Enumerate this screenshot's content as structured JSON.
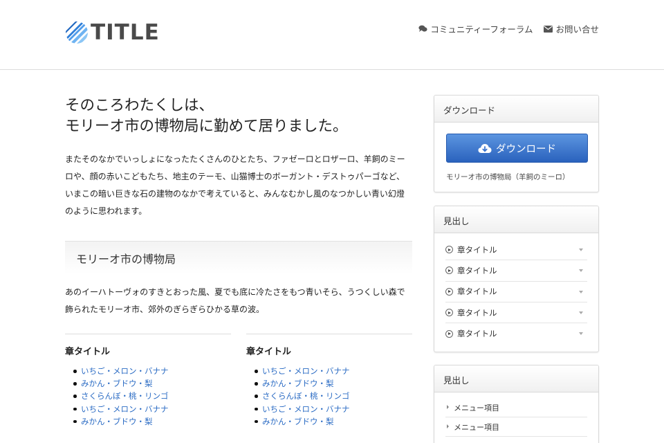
{
  "header": {
    "logo_text": "TITLE",
    "nav": [
      {
        "label": "コミュニティーフォーラム",
        "icon": "chat-icon"
      },
      {
        "label": "お問い合せ",
        "icon": "mail-icon"
      }
    ]
  },
  "main": {
    "headline_line1": "そのころわたくしは、",
    "headline_line2": "モリーオ市の博物局に勤めて居りました。",
    "intro": "またそのなかでいっしょになったたくさんのひとたち、ファゼーロとロザーロ、羊飼のミーロや、顔の赤いこどもたち、地主のテーモ、山猫博士のボーガント・デストゥパーゴなど、いまこの暗い巨きな石の建物のなかで考えていると、みんなむかし風のなつかしい青い幻燈のように思われます。",
    "section_title": "モリーオ市の博物局",
    "section_text": "あのイーハトーヴォのすきとおった風、夏でも底に冷たさをもつ青いそら、うつくしい森で飾られたモリーオ市、郊外のぎらぎらひかる草の波。",
    "columns": [
      {
        "title": "章タイトル",
        "items": [
          "いちご・メロン・バナナ",
          "みかん・ブドウ・梨",
          "さくらんぼ・桃・リンゴ",
          "いちご・メロン・バナナ",
          "みかん・ブドウ・梨"
        ]
      },
      {
        "title": "章タイトル",
        "items": [
          "いちご・メロン・バナナ",
          "みかん・ブドウ・梨",
          "さくらんぼ・桃・リンゴ",
          "いちご・メロン・バナナ",
          "みかん・ブドウ・梨"
        ]
      }
    ]
  },
  "sidebar": {
    "download": {
      "title": "ダウンロード",
      "button_label": "ダウンロード",
      "button_icon": "cloud-download-icon",
      "caption": "モリーオ市の博物局（羊飼のミーロ）"
    },
    "accordion": {
      "title": "見出し",
      "items": [
        "章タイトル",
        "章タイトル",
        "章タイトル",
        "章タイトル",
        "章タイトル"
      ]
    },
    "menu": {
      "title": "見出し",
      "items": [
        "メニュー項目",
        "メニュー項目"
      ]
    }
  },
  "colors": {
    "link": "#2a6bc4",
    "button_top": "#5c95e0",
    "button_bottom": "#2a62bd",
    "logo_blue": "#3a8ee6"
  }
}
